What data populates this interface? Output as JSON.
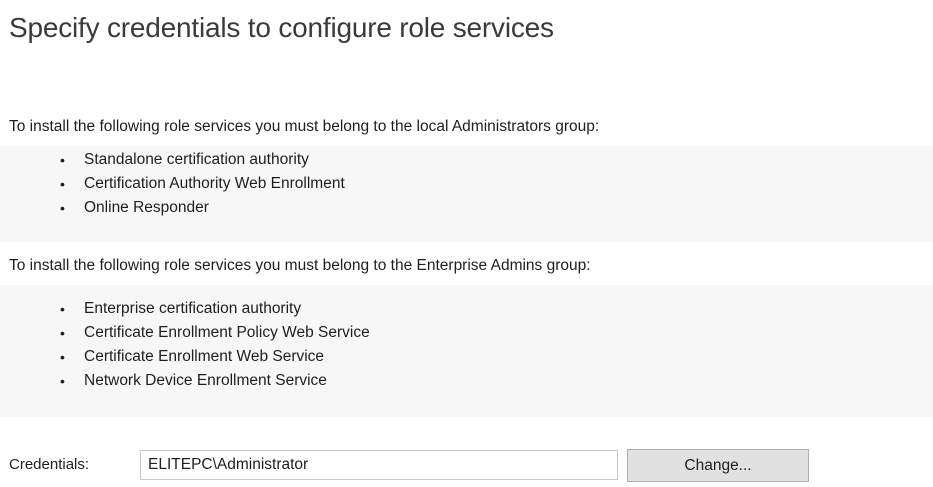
{
  "page": {
    "title": "Specify credentials to configure role services"
  },
  "local_admin_section": {
    "intro": "To install the following role services you must belong to the local Administrators group:",
    "items": [
      "Standalone certification authority",
      "Certification Authority Web Enrollment",
      "Online Responder"
    ]
  },
  "enterprise_admin_section": {
    "intro": "To install the following role services you must belong to the Enterprise Admins group:",
    "items": [
      "Enterprise certification authority",
      "Certificate Enrollment Policy Web Service",
      "Certificate Enrollment Web Service",
      "Network Device Enrollment Service"
    ]
  },
  "credentials": {
    "label": "Credentials:",
    "value": "ELITEPC\\Administrator",
    "change_label": "Change..."
  },
  "icons": {
    "bullet": "•"
  },
  "colors": {
    "background": "#ffffff",
    "list_background": "#f7f7f7",
    "button_background": "#e1e1e1",
    "input_border": "#c8c8c8"
  }
}
